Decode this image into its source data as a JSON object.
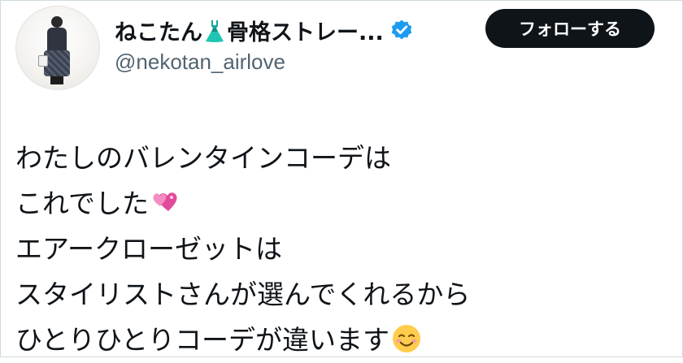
{
  "profile": {
    "display_name_prefix": "ねこたん",
    "display_name_suffix": "骨格ストレー...",
    "name_emoji": "dress-icon",
    "handle": "@nekotan_airlove",
    "verified": true,
    "verified_color": "#1d9bf0"
  },
  "actions": {
    "follow_label": "フォローする"
  },
  "tweet": {
    "lines": [
      "わたしのバレンタインコーデは",
      "これでした",
      "エアークローゼットは",
      "スタイリストさんが選んでくれるから",
      "ひとりひとりコーデが違います"
    ],
    "line2_emoji": "two-hearts-icon",
    "line5_emoji": "smiling-face-icon"
  },
  "colors": {
    "text": "#0f1419",
    "secondary_text": "#536471",
    "button_bg": "#0f1419",
    "button_text": "#ffffff",
    "border": "#cfd9de"
  }
}
